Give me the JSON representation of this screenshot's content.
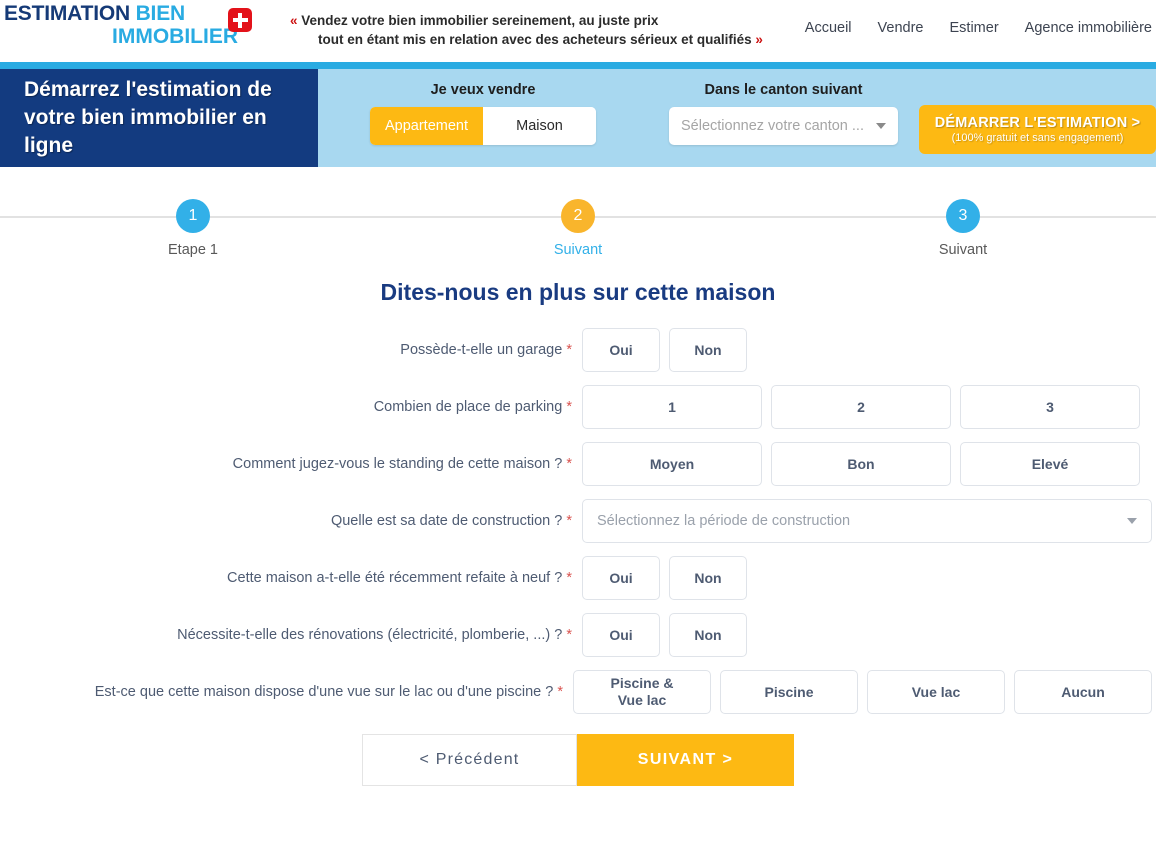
{
  "header": {
    "logo": {
      "word1": "ESTIMATION",
      "word2": "BIEN",
      "word3": "IMMOBILIER"
    },
    "tagline": {
      "open": "«",
      "line1": "Vendez votre bien immobilier sereinement, au juste prix",
      "line2": "tout en étant mis en relation avec des acheteurs sérieux et qualifiés",
      "close": "»"
    },
    "nav": [
      {
        "label": "Accueil"
      },
      {
        "label": "Vendre"
      },
      {
        "label": "Estimer"
      },
      {
        "label": "Agence immobilière"
      }
    ]
  },
  "banner": {
    "heading_line1": "Démarrez l'estimation de",
    "heading_line2": "votre bien immobilier en ligne",
    "sell_label": "Je veux vendre",
    "sell_options": [
      {
        "label": "Appartement",
        "selected": true
      },
      {
        "label": "Maison",
        "selected": false
      }
    ],
    "canton_label": "Dans le canton suivant",
    "canton_placeholder": "Sélectionnez votre canton ...",
    "cta_main": "DÉMARRER L'ESTIMATION >",
    "cta_sub": "(100% gratuit et sans engagement)"
  },
  "stepper": {
    "steps": [
      {
        "number": "1",
        "label": "Etape 1",
        "color": "#32b0e8",
        "active": false
      },
      {
        "number": "2",
        "label": "Suivant",
        "color": "#f9b52c",
        "active": true
      },
      {
        "number": "3",
        "label": "Suivant",
        "color": "#32b0e8",
        "active": false
      }
    ]
  },
  "form": {
    "title": "Dites-nous en plus sur cette maison",
    "required_mark": "*",
    "rows": [
      {
        "label": "Possède-t-elle un garage",
        "type": "buttons",
        "options": [
          "Oui",
          "Non"
        ]
      },
      {
        "label": "Combien de place de parking",
        "type": "buttons",
        "options": [
          "1",
          "2",
          "3"
        ]
      },
      {
        "label": "Comment jugez-vous le standing de cette maison ?",
        "type": "buttons",
        "options": [
          "Moyen",
          "Bon",
          "Elevé"
        ]
      },
      {
        "label": "Quelle est sa date de construction ?",
        "type": "select",
        "placeholder": "Sélectionnez la période de construction"
      },
      {
        "label": "Cette maison a-t-elle été récemment refaite à neuf ?",
        "type": "buttons",
        "options": [
          "Oui",
          "Non"
        ]
      },
      {
        "label": "Nécessite-t-elle des rénovations (électricité, plomberie, ...) ?",
        "type": "buttons",
        "options": [
          "Oui",
          "Non"
        ]
      },
      {
        "label": "Est-ce que cette maison dispose d'une vue sur le lac ou d'une piscine ?",
        "type": "buttons",
        "options": [
          "Piscine &\nVue lac",
          "Piscine",
          "Vue lac",
          "Aucun"
        ]
      }
    ],
    "prev_label": "<  Précédent",
    "next_label": "SUIVANT  >"
  },
  "colors": {
    "navy": "#133b80",
    "light_blue": "#29abe2",
    "banner_bg": "#a8d8f0",
    "amber": "#fdb913",
    "step_blue": "#32b0e8",
    "step_orange": "#f9b52c",
    "label_gray": "#4e5b72",
    "required_red": "#d9534f",
    "swiss_red": "#e3121a"
  }
}
